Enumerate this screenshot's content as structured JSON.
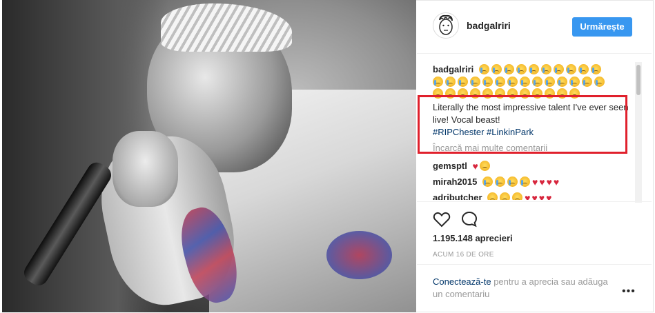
{
  "post": {
    "username": "badgalriri",
    "follow_label": "Urmărește",
    "caption_user": "badgalriri",
    "caption_text": "Literally the most impressive talent I've ever seen live! Vocal beast!",
    "hashtags": "#RIPChester #LinkinPark",
    "load_more": "Încarcă mai multe comentarii",
    "comments": [
      {
        "user": "gemsptl"
      },
      {
        "user": "mirah2015"
      },
      {
        "user": "adributcher"
      }
    ],
    "likes": "1.195.148 aprecieri",
    "time": "ACUM 16 DE ORE",
    "login_link": "Conectează-te",
    "login_rest": "pentru a aprecia sau adăuga un comentariu"
  },
  "icons": {
    "like": "heart-outline-icon",
    "comment": "speech-bubble-icon",
    "more": "ellipsis-icon"
  },
  "colors": {
    "accent": "#3897f0",
    "highlight_box": "#e0202c",
    "hashtag": "#003569"
  }
}
